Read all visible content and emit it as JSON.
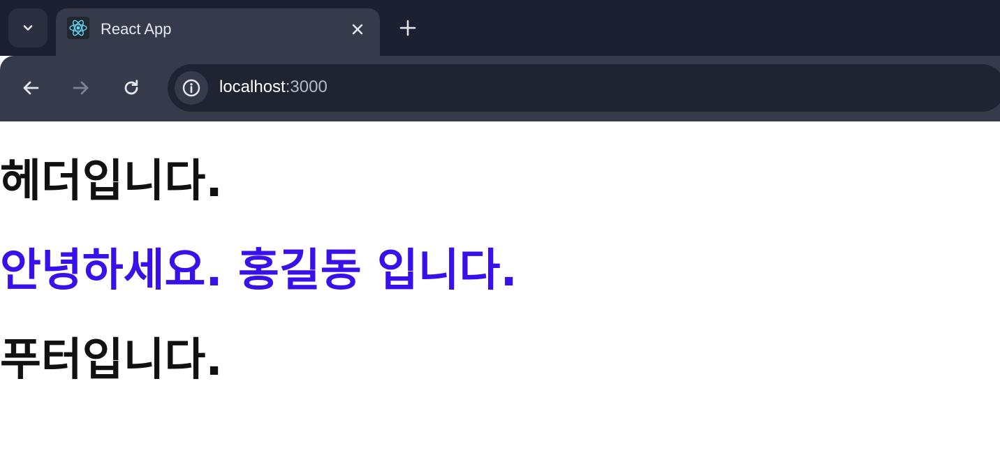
{
  "browser": {
    "tab": {
      "title": "React App"
    },
    "address_bar": {
      "host": "localhost",
      "port": ":3000"
    }
  },
  "page": {
    "header": "헤더입니다.",
    "greeting": "안녕하세요. 홍길동 입니다.",
    "footer": "푸터입니다."
  },
  "icons": {
    "tab_search": "chevron-down-icon",
    "favicon": "react-logo-icon",
    "tab_close": "close-icon",
    "new_tab": "plus-icon",
    "back": "arrow-left-icon",
    "forward": "arrow-right-icon",
    "reload": "reload-icon",
    "site_info": "info-icon"
  },
  "colors": {
    "greeting_text": "#3a10ea",
    "heading_text": "#111111",
    "tabstrip_bg": "#1c2030",
    "toolbar_bg": "#363b4b",
    "omnibox_bg": "#1f2433"
  }
}
